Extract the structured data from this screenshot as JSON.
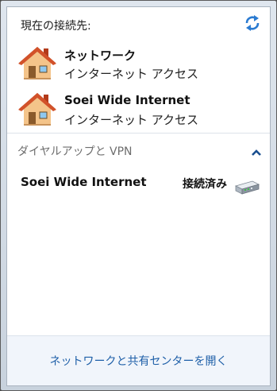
{
  "header": {
    "label": "現在の接続先:"
  },
  "connections": [
    {
      "name": "ネットワーク",
      "status": "インターネット アクセス"
    },
    {
      "name": "Soei Wide Internet",
      "status": "インターネット アクセス"
    }
  ],
  "dialup": {
    "section_title": "ダイヤルアップと VPN",
    "items": [
      {
        "name": "Soei Wide Internet",
        "status": "接続済み"
      }
    ]
  },
  "footer": {
    "link_label": "ネットワークと共有センターを開く"
  },
  "icons": {
    "refresh": "refresh-icon",
    "connection": "house-icon",
    "collapse": "chevron-up-icon",
    "dialup": "modem-icon"
  },
  "colors": {
    "link": "#1e5fa8",
    "section_title": "#6d6d6d",
    "accent": "#1a6ec2"
  }
}
